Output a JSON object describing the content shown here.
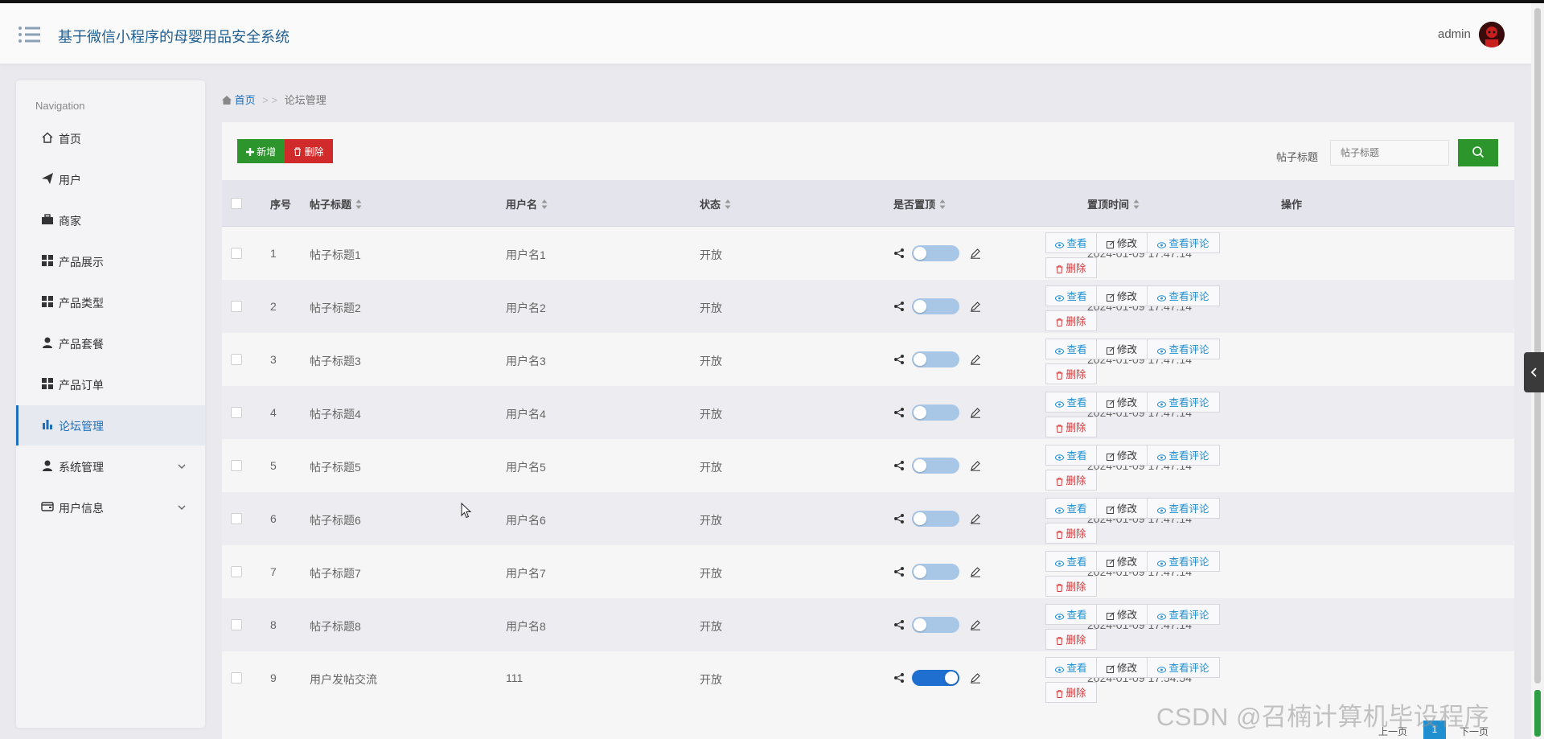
{
  "header": {
    "app_title": "基于微信小程序的母婴用品安全系统",
    "user_name": "admin"
  },
  "sidebar": {
    "heading": "Navigation",
    "items": [
      {
        "label": "首页",
        "icon": "home-icon"
      },
      {
        "label": "用户",
        "icon": "paper-plane-icon"
      },
      {
        "label": "商家",
        "icon": "briefcase-icon"
      },
      {
        "label": "产品展示",
        "icon": "grid-icon"
      },
      {
        "label": "产品类型",
        "icon": "grid-icon"
      },
      {
        "label": "产品套餐",
        "icon": "user-icon"
      },
      {
        "label": "产品订单",
        "icon": "grid-icon"
      },
      {
        "label": "论坛管理",
        "icon": "bar-chart-icon",
        "active": true
      },
      {
        "label": "系统管理",
        "icon": "user-icon",
        "expandable": true
      },
      {
        "label": "用户信息",
        "icon": "card-icon",
        "expandable": true
      }
    ]
  },
  "breadcrumb": {
    "home": "首页",
    "separator": "> >",
    "current": "论坛管理"
  },
  "toolbar": {
    "add_label": "新增",
    "delete_label": "删除",
    "search_label": "帖子标题",
    "search_placeholder": "帖子标题"
  },
  "table": {
    "headers": [
      "序号",
      "帖子标题",
      "用户名",
      "状态",
      "是否置顶",
      "置顶时间",
      "操作"
    ],
    "rows": [
      {
        "no": "1",
        "title": "帖子标题1",
        "user": "用户名1",
        "status": "开放",
        "pinned": false,
        "time": "2024-01-09 17:47:14"
      },
      {
        "no": "2",
        "title": "帖子标题2",
        "user": "用户名2",
        "status": "开放",
        "pinned": false,
        "time": "2024-01-09 17:47:14"
      },
      {
        "no": "3",
        "title": "帖子标题3",
        "user": "用户名3",
        "status": "开放",
        "pinned": false,
        "time": "2024-01-09 17:47:14"
      },
      {
        "no": "4",
        "title": "帖子标题4",
        "user": "用户名4",
        "status": "开放",
        "pinned": false,
        "time": "2024-01-09 17:47:14"
      },
      {
        "no": "5",
        "title": "帖子标题5",
        "user": "用户名5",
        "status": "开放",
        "pinned": false,
        "time": "2024-01-09 17:47:14"
      },
      {
        "no": "6",
        "title": "帖子标题6",
        "user": "用户名6",
        "status": "开放",
        "pinned": false,
        "time": "2024-01-09 17:47:14"
      },
      {
        "no": "7",
        "title": "帖子标题7",
        "user": "用户名7",
        "status": "开放",
        "pinned": false,
        "time": "2024-01-09 17:47:14"
      },
      {
        "no": "8",
        "title": "帖子标题8",
        "user": "用户名8",
        "status": "开放",
        "pinned": false,
        "time": "2024-01-09 17:47:14"
      },
      {
        "no": "9",
        "title": "用户发帖交流",
        "user": "111",
        "status": "开放",
        "pinned": true,
        "time": "2024-01-09 17:54:54"
      }
    ],
    "actions": {
      "view": "查看",
      "edit": "修改",
      "comments": "查看评论",
      "delete": "删除"
    }
  },
  "pagination": {
    "prev": "上一页",
    "current": "1",
    "next": "下一页"
  },
  "watermark": "CSDN @召楠计算机毕设程序",
  "colors": {
    "primary": "#1f6fb8",
    "success": "#2c962c",
    "danger": "#d12a2a",
    "link": "#1f8fd0"
  }
}
